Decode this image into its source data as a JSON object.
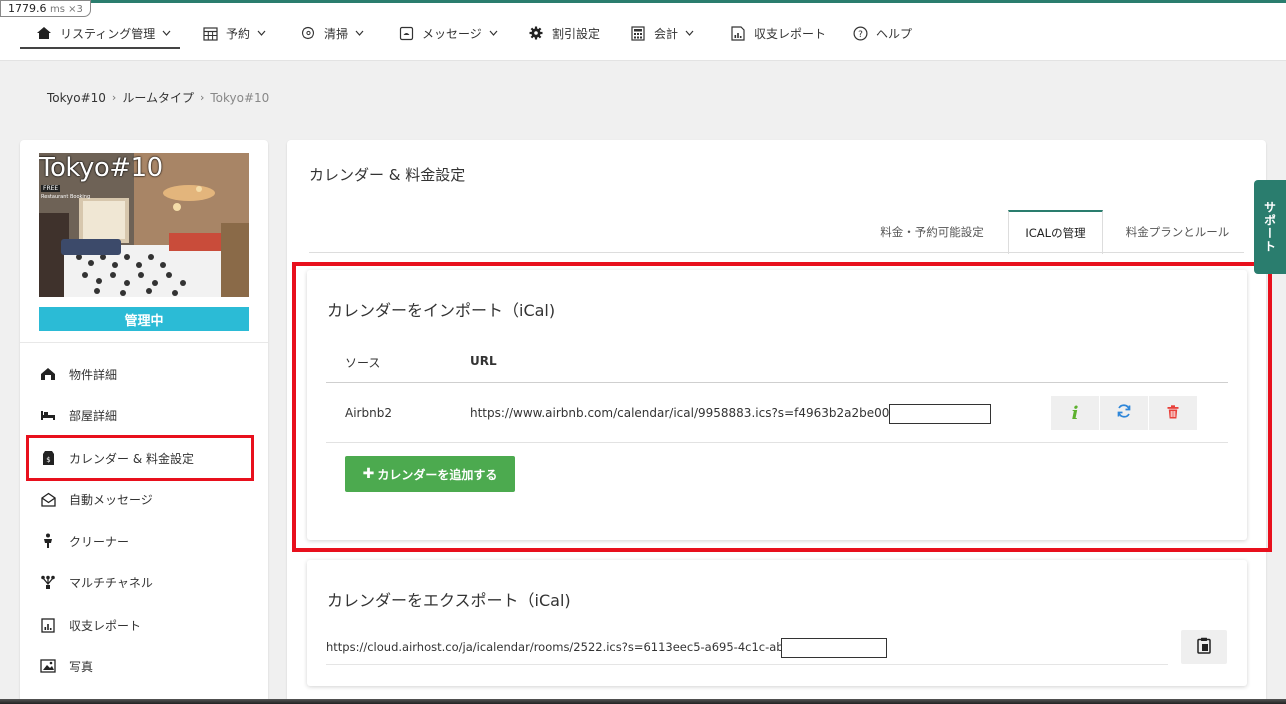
{
  "perf": {
    "value": "1779.6",
    "unit": "ms ×3"
  },
  "nav": {
    "items": [
      {
        "label": "リスティング管理",
        "icon": "home-icon",
        "dropdown": true
      },
      {
        "label": "予約",
        "icon": "calendar-icon",
        "dropdown": true
      },
      {
        "label": "清掃",
        "icon": "cleaning-icon",
        "dropdown": true
      },
      {
        "label": "メッセージ",
        "icon": "message-icon",
        "dropdown": true
      },
      {
        "label": "割引設定",
        "icon": "gear-icon",
        "dropdown": false
      },
      {
        "label": "会計",
        "icon": "calculator-icon",
        "dropdown": true
      },
      {
        "label": "収支レポート",
        "icon": "report-icon",
        "dropdown": false
      },
      {
        "label": "ヘルプ",
        "icon": "help-icon",
        "dropdown": false
      }
    ]
  },
  "breadcrumb": {
    "level1": "Tokyo#10",
    "level2": "ルームタイプ",
    "current": "Tokyo#10",
    "separator": "›"
  },
  "sidebar": {
    "listing_title": "Tokyo#10",
    "photo_tag": "FREE",
    "photo_sub": "Restaurant Booking",
    "status": "管理中",
    "items": [
      {
        "label": "物件詳細",
        "icon": "property-icon"
      },
      {
        "label": "部屋詳細",
        "icon": "bed-icon"
      },
      {
        "label": "カレンダー & 料金設定",
        "icon": "price-tag-icon"
      },
      {
        "label": "自動メッセージ",
        "icon": "mail-icon"
      },
      {
        "label": "クリーナー",
        "icon": "cleaner-icon"
      },
      {
        "label": "マルチチャネル",
        "icon": "channel-icon"
      },
      {
        "label": "収支レポート",
        "icon": "report-icon"
      },
      {
        "label": "写真",
        "icon": "photo-icon"
      }
    ]
  },
  "main": {
    "title": "カレンダー & 料金設定",
    "tabs": [
      {
        "label": "料金・予約可能設定",
        "active": false
      },
      {
        "label": "ICALの管理",
        "active": true
      },
      {
        "label": "料金プランとルール",
        "active": false
      }
    ]
  },
  "import": {
    "title": "カレンダーをインポート（iCal)",
    "col_source": "ソース",
    "col_url": "URL",
    "rows": [
      {
        "source": "Airbnb2",
        "url": "https://www.airbnb.com/calendar/ical/9958883.ics?s=f4963b2a2be008cf5"
      }
    ],
    "add_button": "カレンダーを追加する"
  },
  "export": {
    "title": "カレンダーをエクスポート（iCal)",
    "url": "https://cloud.airhost.co/ja/icalendar/rooms/2522.ics?s=6113eec5-a695-4c1c-ab7f"
  },
  "support": {
    "label": "サポート"
  },
  "colors": {
    "accent": "#2a7d6e",
    "status": "#2bbbd6",
    "add": "#4caa4f",
    "highlight": "#e8101d",
    "delete": "#e8403a",
    "refresh": "#2e86d9",
    "info": "#5db12f"
  }
}
